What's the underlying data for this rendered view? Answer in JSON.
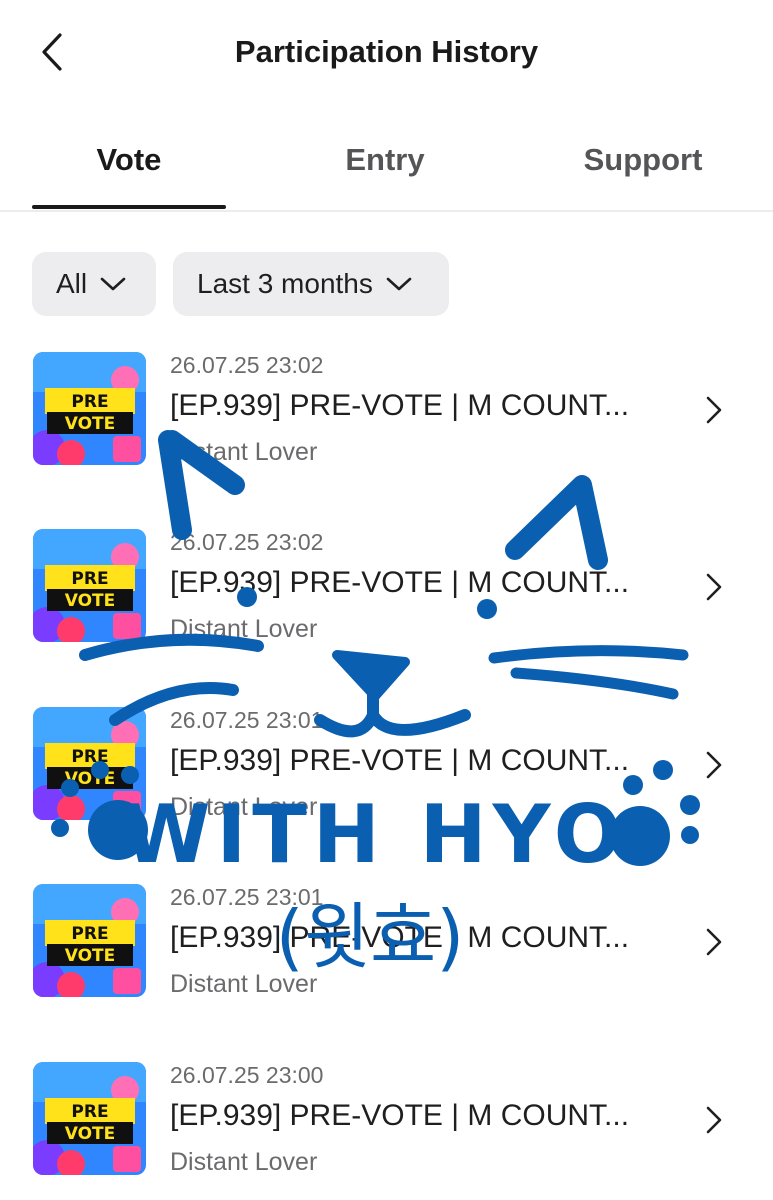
{
  "header": {
    "title": "Participation History",
    "back_icon": "chevron-left-icon"
  },
  "tabs": [
    {
      "label": "Vote",
      "active": true
    },
    {
      "label": "Entry",
      "active": false
    },
    {
      "label": "Support",
      "active": false
    }
  ],
  "filters": {
    "category": "All",
    "period": "Last 3 months"
  },
  "thumbnail": {
    "line1": "PRE",
    "line2": "VOTE"
  },
  "items": [
    {
      "date": "26.07.25 23:02",
      "title": "[EP.939] PRE-VOTE | M COUNT...",
      "subtitle": "Distant Lover"
    },
    {
      "date": "26.07.25 23:02",
      "title": "[EP.939] PRE-VOTE | M COUNT...",
      "subtitle": "Distant Lover"
    },
    {
      "date": "26.07.25 23:01",
      "title": "[EP.939] PRE-VOTE | M COUNT...",
      "subtitle": "Distant Lover"
    },
    {
      "date": "26.07.25 23:01",
      "title": "[EP.939] PRE-VOTE | M COUNT...",
      "subtitle": "Distant Lover"
    },
    {
      "date": "26.07.25 23:00",
      "title": "[EP.939] PRE-VOTE | M COUNT...",
      "subtitle": "Distant Lover"
    }
  ],
  "overlay_drawing": {
    "text": "WITH HYO",
    "sub_text": "(윗효)",
    "color": "#0b5fb0"
  },
  "colors": {
    "active_tab": "#1a1a1a",
    "chip_bg": "#ededf0",
    "muted_text": "#6b6b6e"
  }
}
